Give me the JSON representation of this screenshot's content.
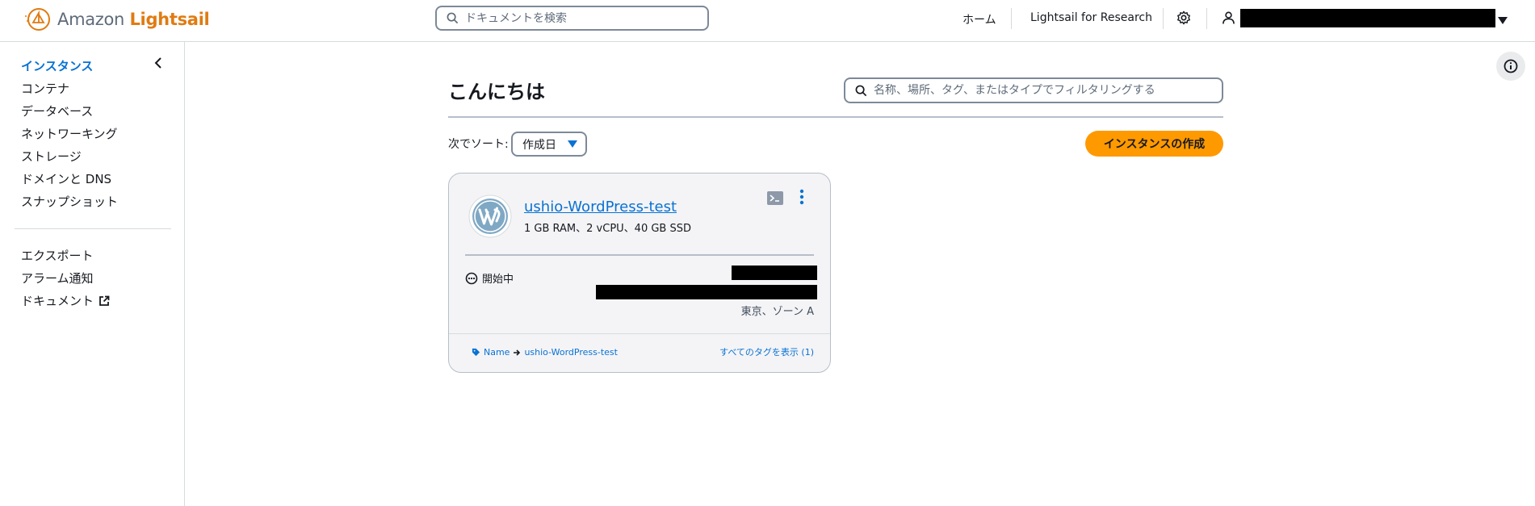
{
  "header": {
    "logo_prefix": "Amazon",
    "logo_brand": "Lightsail",
    "search_placeholder": "ドキュメントを検索",
    "home_label": "ホーム",
    "research_label": "Lightsail for Research"
  },
  "sidebar": {
    "items": [
      {
        "label": "インスタンス"
      },
      {
        "label": "コンテナ"
      },
      {
        "label": "データベース"
      },
      {
        "label": "ネットワーキング"
      },
      {
        "label": "ストレージ"
      },
      {
        "label": "ドメインと DNS"
      },
      {
        "label": "スナップショット"
      }
    ],
    "secondary": [
      {
        "label": "エクスポート"
      },
      {
        "label": "アラーム通知"
      },
      {
        "label": "ドキュメント"
      }
    ]
  },
  "main": {
    "greeting": "こんにちは",
    "filter_placeholder": "名称、場所、タグ、またはタイプでフィルタリングする",
    "sort_label": "次でソート:",
    "sort_value": "作成日",
    "create_button": "インスタンスの作成"
  },
  "instance": {
    "name": "ushio-WordPress-test",
    "spec": "1 GB RAM、2 vCPU、40 GB SSD",
    "status": "開始中",
    "location": "東京、ゾーン A",
    "tag_key": "Name",
    "tag_value": "ushio-WordPress-test",
    "all_tags": "すべてのタグを表示 (1)"
  },
  "colors": {
    "accent": "#0972d3",
    "brand": "#e07b12",
    "primary_button": "#ff9900"
  }
}
